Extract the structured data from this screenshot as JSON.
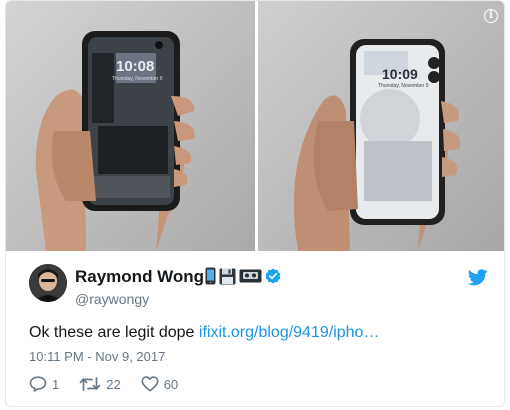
{
  "colors": {
    "link": "#1b95e0",
    "text_primary": "#14171a",
    "text_secondary": "#657786",
    "verified": "#1da1f2",
    "twitter_brand": "#1da1f2"
  },
  "media": {
    "info_icon": "info-icon",
    "left_photo": {
      "screen_time": "10:08",
      "screen_date": "Thursday, November 9"
    },
    "right_photo": {
      "screen_time": "10:09",
      "screen_date": "Thursday, November 9"
    }
  },
  "author": {
    "name": "Raymond Wong",
    "handle": "@raywongy",
    "name_emojis": [
      "mobile-phone-icon",
      "floppy-disk-icon",
      "videocassette-icon"
    ],
    "verified_icon": "verified-badge-icon"
  },
  "tweet": {
    "text": "Ok these are legit dope",
    "link": "ifixit.org/blog/9419/ipho…",
    "timestamp": "10:11 PM - Nov 9, 2017"
  },
  "actions": {
    "replies": "1",
    "retweets": "22",
    "likes": "60"
  },
  "brand_icon": "twitter-bird-icon"
}
